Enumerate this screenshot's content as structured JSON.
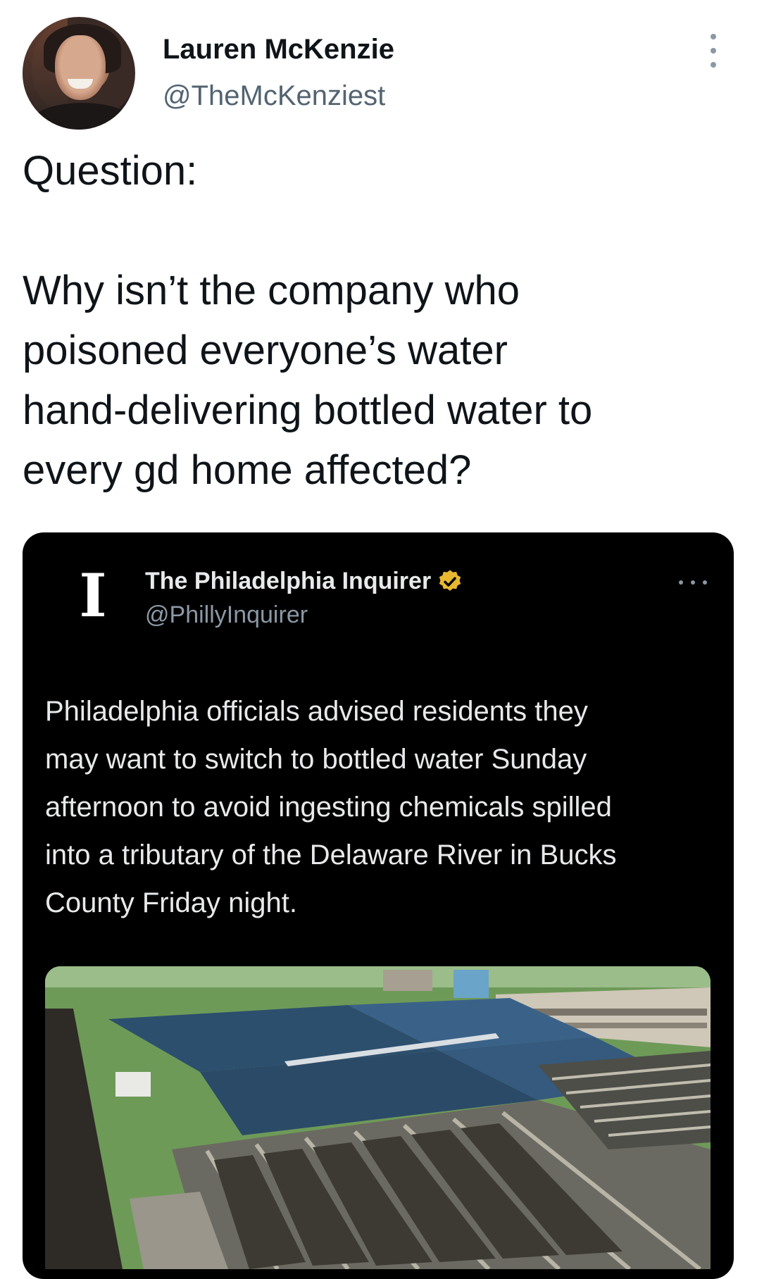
{
  "author": {
    "name": "Lauren McKenzie",
    "handle": "@TheMcKenziest",
    "avatar_icon": "profile-photo"
  },
  "tweet": {
    "lines": [
      "Question:",
      "",
      "Why isn’t the company who",
      "poisoned everyone’s water",
      "hand-delivering bottled water to",
      "every gd home affected?"
    ]
  },
  "quoted_tweet": {
    "name": "The Philadelphia Inquirer",
    "handle": "@PhillyInquirer",
    "logo_glyph": "I",
    "verified_color": "#e8b830",
    "lines": [
      "Philadelphia officials advised residents they",
      "may want to switch to bottled water Sunday",
      "afternoon to avoid ingesting chemicals spilled",
      "into a tributary of the Delaware River in Bucks",
      "County Friday night."
    ],
    "image_icon": "water-treatment-plant-photo"
  },
  "colors": {
    "text_primary": "#0f1419",
    "text_secondary": "#536471",
    "quote_bg": "#000000",
    "quote_text": "#e7e9ea",
    "quote_secondary": "#8b98a5"
  }
}
